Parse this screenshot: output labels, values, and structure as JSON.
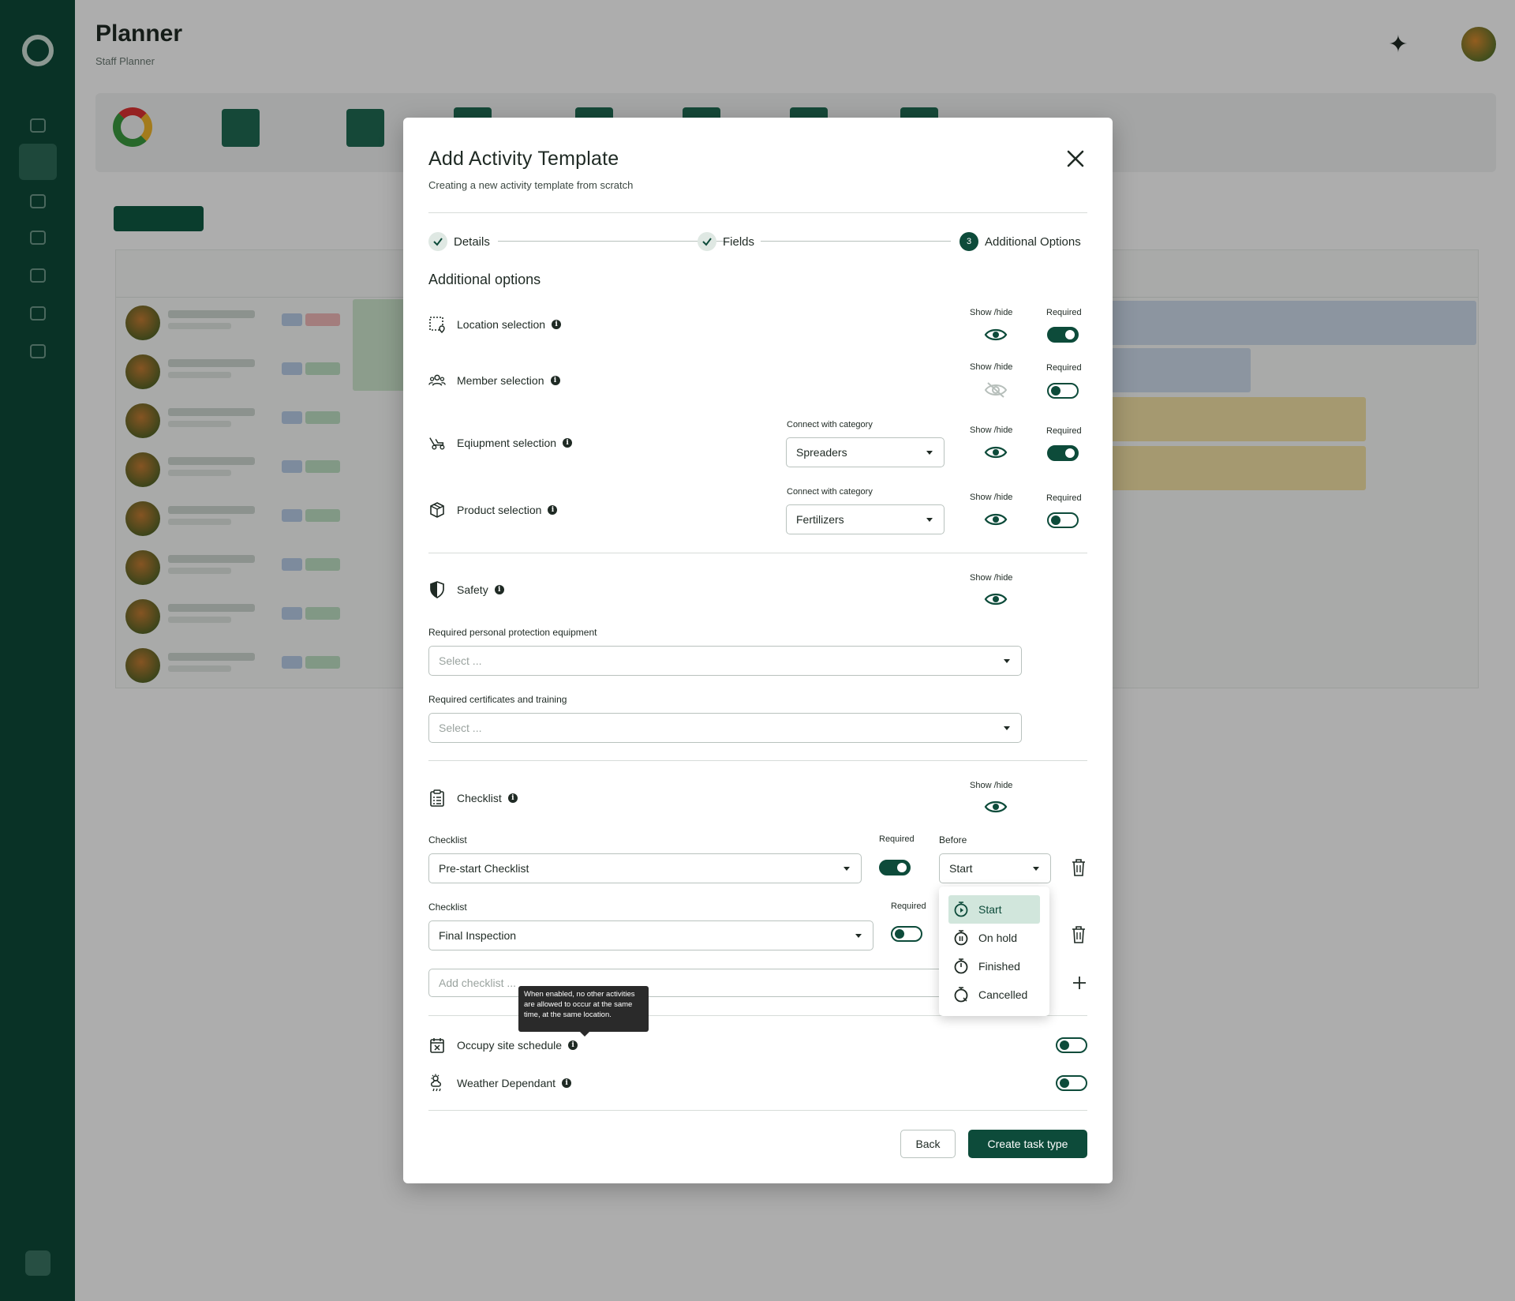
{
  "background": {
    "page_title": "Planner",
    "page_subtitle": "Staff Planner"
  },
  "modal": {
    "title": "Add Activity Template",
    "subtitle": "Creating a new activity template from scratch",
    "close_icon": "close-icon"
  },
  "stepper": {
    "steps": [
      {
        "label": "Details",
        "state": "done"
      },
      {
        "label": "Fields",
        "state": "done"
      },
      {
        "label": "Additional Options",
        "state": "current",
        "number": "3"
      }
    ]
  },
  "section_title": "Additional options",
  "columns": {
    "show_hide": "Show /hide",
    "required": "Required",
    "connect": "Connect with category"
  },
  "options": [
    {
      "label": "Location selection",
      "icon": "location-selection-icon",
      "visible": true,
      "required": true
    },
    {
      "label": "Member selection",
      "icon": "members-icon",
      "visible": false,
      "required": false
    },
    {
      "label": "Eqiupment selection",
      "icon": "equipment-icon",
      "visible": true,
      "required": true,
      "category": "Spreaders"
    },
    {
      "label": "Product selection",
      "icon": "box-icon",
      "visible": true,
      "required": false,
      "category": "Fertilizers"
    }
  ],
  "safety": {
    "label": "Safety",
    "visible": true,
    "ppe_label": "Required personal protection equipment",
    "ppe_placeholder": "Select ...",
    "cert_label": "Required certificates and training",
    "cert_placeholder": "Select ..."
  },
  "checklist": {
    "label": "Checklist",
    "visible": true,
    "field_label": "Checklist",
    "required_label": "Required",
    "before_label": "Before",
    "items": [
      {
        "name": "Pre-start Checklist",
        "required": true,
        "before": "Start"
      },
      {
        "name": "Final Inspection",
        "required": false
      }
    ],
    "add_placeholder": "Add checklist ...",
    "before_menu": [
      "Start",
      "On hold",
      "Finished",
      "Cancelled"
    ],
    "before_menu_selected": "Start"
  },
  "occupy": {
    "label": "Occupy site schedule",
    "enabled": false,
    "tooltip": "When enabled, no other activities are allowed to occur at the same time, at the same location."
  },
  "weather": {
    "label": "Weather Dependant",
    "enabled": false
  },
  "footer": {
    "back": "Back",
    "create": "Create task type"
  },
  "colors": {
    "brand": "#0d4b3a",
    "sidebar": "#0e4a39",
    "menu_active": "#d1e6dc"
  }
}
